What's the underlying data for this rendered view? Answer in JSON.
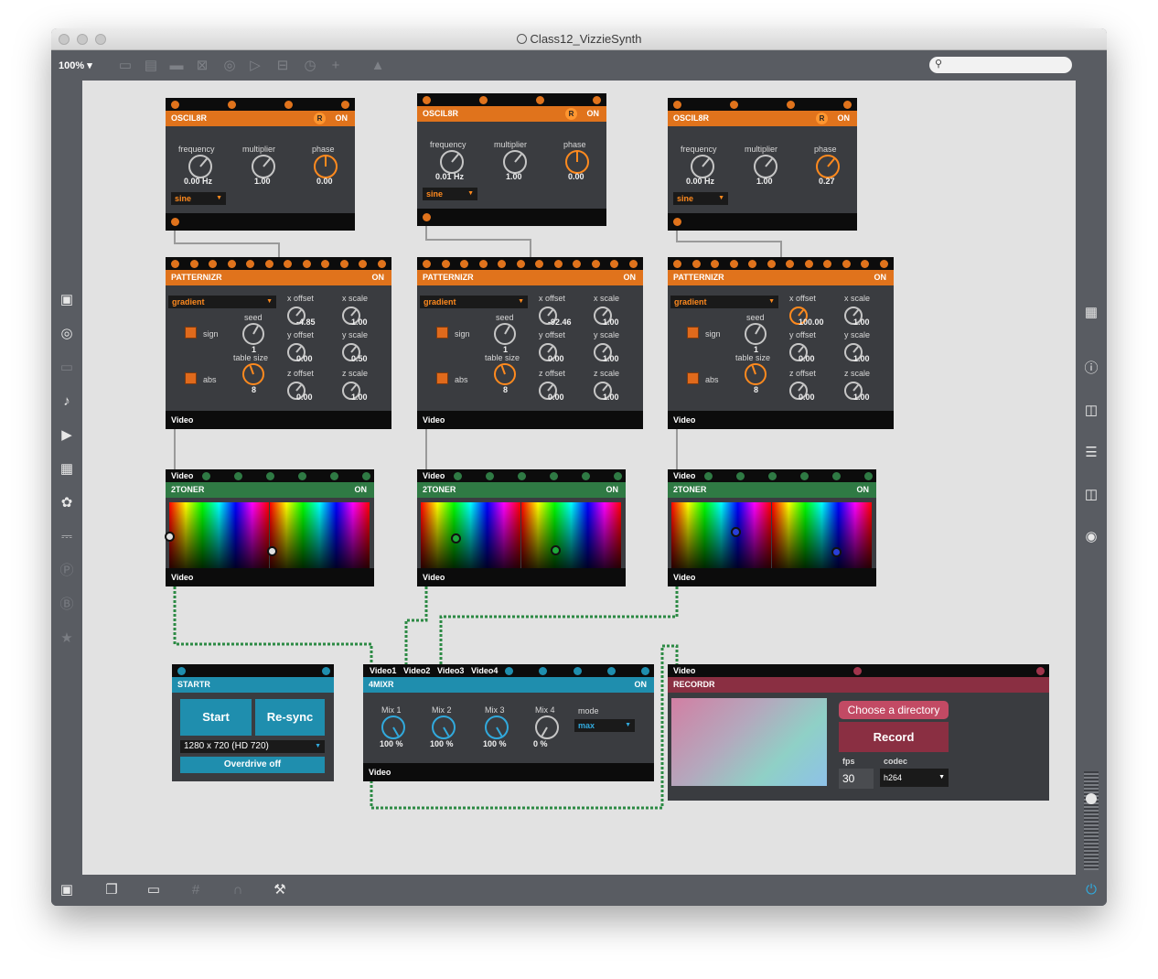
{
  "window": {
    "title": "Class12_VizzieSynth",
    "zoom": "100%",
    "toolbar_icons": [
      "presentation-icon",
      "message-icon",
      "comment-icon",
      "toggle-icon",
      "button-icon",
      "playbar-icon",
      "slider-icon",
      "dial-icon",
      "add-icon",
      "paint-bucket-icon"
    ],
    "left_icons": [
      "package-icon",
      "target-icon",
      "panel-icon",
      "music-note-icon",
      "play-list-icon",
      "image-icon",
      "paperclip-icon",
      "plug-icon",
      "v-circle-icon",
      "b-circle-icon",
      "star-icon"
    ],
    "right_icons": [
      "grid-icon",
      "info-icon",
      "book-open-icon",
      "list-icon",
      "reference-icon",
      "camera-icon"
    ],
    "bottom_icons": [
      "lock-icon",
      "windows-icon",
      "presentation-icon",
      "grid-icon",
      "magnet-icon",
      "wrench-icon",
      "power-icon"
    ]
  },
  "oscil8r": [
    {
      "title": "OSCIL8R",
      "rec": "R",
      "on": "ON",
      "frequency_label": "frequency",
      "multiplier_label": "multiplier",
      "phase_label": "phase",
      "frequency": "0.00 Hz",
      "multiplier": "1.00",
      "phase": "0.00",
      "shape": "sine"
    },
    {
      "title": "OSCIL8R",
      "rec": "R",
      "on": "ON",
      "frequency_label": "frequency",
      "multiplier_label": "multiplier",
      "phase_label": "phase",
      "frequency": "0.01 Hz",
      "multiplier": "1.00",
      "phase": "0.00",
      "shape": "sine"
    },
    {
      "title": "OSCIL8R",
      "rec": "R",
      "on": "ON",
      "frequency_label": "frequency",
      "multiplier_label": "multiplier",
      "phase_label": "phase",
      "frequency": "0.00 Hz",
      "multiplier": "1.00",
      "phase": "0.27",
      "shape": "sine"
    }
  ],
  "patternizr": [
    {
      "title": "PATTERNIZR",
      "on": "ON",
      "mode": "gradient",
      "sign_label": "sign",
      "abs_label": "abs",
      "seed_label": "seed",
      "seed": "1",
      "table_size_label": "table size",
      "table_size": "8",
      "x_offset_label": "x offset",
      "x_offset": "-4.85",
      "y_offset_label": "y offset",
      "y_offset": "0.00",
      "z_offset_label": "z offset",
      "z_offset": "0.00",
      "x_scale_label": "x scale",
      "x_scale": "1.00",
      "y_scale_label": "y scale",
      "y_scale": "0.50",
      "z_scale_label": "z scale",
      "z_scale": "1.00",
      "footer": "Video"
    },
    {
      "title": "PATTERNIZR",
      "on": "ON",
      "mode": "gradient",
      "sign_label": "sign",
      "abs_label": "abs",
      "seed_label": "seed",
      "seed": "1",
      "table_size_label": "table size",
      "table_size": "8",
      "x_offset_label": "x offset",
      "x_offset": "-92.46",
      "y_offset_label": "y offset",
      "y_offset": "0.00",
      "z_offset_label": "z offset",
      "z_offset": "0.00",
      "x_scale_label": "x scale",
      "x_scale": "1.00",
      "y_scale_label": "y scale",
      "y_scale": "1.00",
      "z_scale_label": "z scale",
      "z_scale": "1.00",
      "footer": "Video"
    },
    {
      "title": "PATTERNIZR",
      "on": "ON",
      "mode": "gradient",
      "sign_label": "sign",
      "abs_label": "abs",
      "seed_label": "seed",
      "seed": "1",
      "table_size_label": "table size",
      "table_size": "8",
      "x_offset_label": "x offset",
      "x_offset": "100.00",
      "y_offset_label": "y offset",
      "y_offset": "0.00",
      "z_offset_label": "z offset",
      "z_offset": "0.00",
      "x_scale_label": "x scale",
      "x_scale": "1.00",
      "y_scale_label": "y scale",
      "y_scale": "1.00",
      "z_scale_label": "z scale",
      "z_scale": "1.00",
      "footer": "Video"
    }
  ],
  "twotoner": [
    {
      "title": "2TONER",
      "on": "ON",
      "inlet": "Video",
      "footer": "Video"
    },
    {
      "title": "2TONER",
      "on": "ON",
      "inlet": "Video",
      "footer": "Video"
    },
    {
      "title": "2TONER",
      "on": "ON",
      "inlet": "Video",
      "footer": "Video"
    }
  ],
  "startr": {
    "title": "STARTR",
    "start": "Start",
    "resync": "Re-sync",
    "resolution": "1280 x 720 (HD 720)",
    "overdrive": "Overdrive off"
  },
  "mixr": {
    "title": "4MIXR",
    "on": "ON",
    "inlets": [
      "Video1",
      "Video2",
      "Video3",
      "Video4"
    ],
    "mix_labels": [
      "Mix 1",
      "Mix 2",
      "Mix 3",
      "Mix 4"
    ],
    "mix_values": [
      "100 %",
      "100 %",
      "100 %",
      "0 %"
    ],
    "mix_levels": [
      1.0,
      1.0,
      1.0,
      0.0
    ],
    "mode_label": "mode",
    "mode": "max",
    "footer": "Video"
  },
  "recordr": {
    "title": "RECORDR",
    "inlet": "Video",
    "choose": "Choose a directory",
    "record": "Record",
    "fps_label": "fps",
    "fps": "30",
    "codec_label": "codec",
    "codec": "h264"
  },
  "colors": {
    "oscil8r": "#e0731c",
    "patternizr": "#e0731c",
    "twotoner": "#2f7a44",
    "startr": "#1f8eae",
    "mixr": "#1f8eae",
    "recordr": "#8a2f42",
    "canvas": "#e2e2e2",
    "chrome": "#595c62"
  }
}
